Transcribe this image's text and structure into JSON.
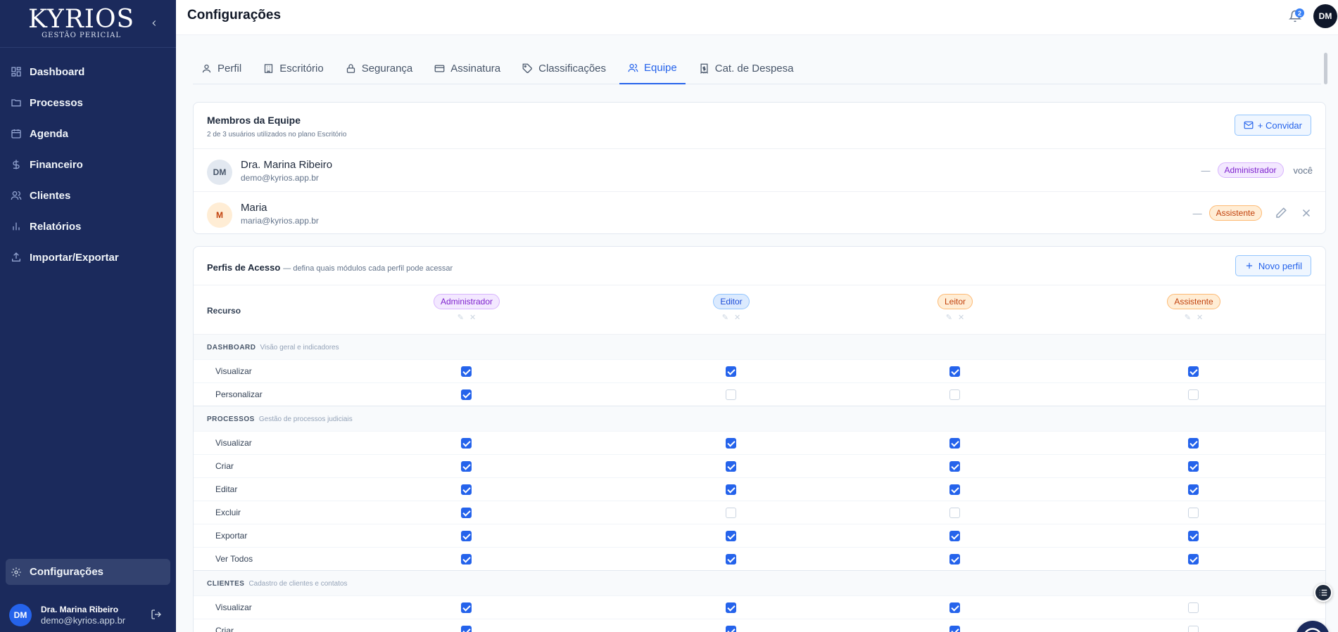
{
  "brand": {
    "name": "KYRIOS",
    "subtitle": "GESTÃO PERICIAL"
  },
  "sidebar": {
    "items": [
      {
        "label": "Dashboard",
        "icon": "grid-icon"
      },
      {
        "label": "Processos",
        "icon": "folder-icon"
      },
      {
        "label": "Agenda",
        "icon": "calendar-icon"
      },
      {
        "label": "Financeiro",
        "icon": "dollar-icon"
      },
      {
        "label": "Clientes",
        "icon": "users-icon"
      },
      {
        "label": "Relatórios",
        "icon": "bar-chart-icon"
      },
      {
        "label": "Importar/Exportar",
        "icon": "upload-icon"
      }
    ],
    "settings_label": "Configurações",
    "user": {
      "initials": "DM",
      "name": "Dra. Marina Ribeiro",
      "email": "demo@kyrios.app.br"
    }
  },
  "header": {
    "title": "Configurações",
    "notification_count": "2",
    "avatar_initials": "DM"
  },
  "tabs": [
    {
      "label": "Perfil",
      "icon": "user-icon"
    },
    {
      "label": "Escritório",
      "icon": "building-icon"
    },
    {
      "label": "Segurança",
      "icon": "lock-icon"
    },
    {
      "label": "Assinatura",
      "icon": "credit-card-icon"
    },
    {
      "label": "Classificações",
      "icon": "tag-icon"
    },
    {
      "label": "Equipe",
      "icon": "users-icon",
      "active": true
    },
    {
      "label": "Cat. de Despesa",
      "icon": "receipt-icon"
    }
  ],
  "team": {
    "title": "Membros da Equipe",
    "subtitle": "2 de 3 usuários utilizados no plano Escritório",
    "invite_label": "+ Convidar",
    "members": [
      {
        "initials": "DM",
        "name": "Dra. Marina Ribeiro",
        "email": "demo@kyrios.app.br",
        "dash": "—",
        "role": "Administrador",
        "suffix": "você"
      },
      {
        "initials": "M",
        "name": "Maria",
        "email": "maria@kyrios.app.br",
        "dash": "—",
        "role": "Assistente"
      }
    ]
  },
  "permissions": {
    "title": "Perfis de Acesso",
    "description": "— defina quais módulos cada perfil pode acessar",
    "new_profile_label": "Novo perfil",
    "resource_header": "Recurso",
    "roles": [
      "Administrador",
      "Editor",
      "Leitor",
      "Assistente"
    ],
    "sections": [
      {
        "name": "DASHBOARD",
        "desc": "Visão geral e indicadores",
        "rows": [
          {
            "label": "Visualizar",
            "values": [
              true,
              true,
              true,
              true
            ]
          },
          {
            "label": "Personalizar",
            "values": [
              true,
              false,
              false,
              false
            ]
          }
        ]
      },
      {
        "name": "PROCESSOS",
        "desc": "Gestão de processos judiciais",
        "rows": [
          {
            "label": "Visualizar",
            "values": [
              true,
              true,
              true,
              true
            ]
          },
          {
            "label": "Criar",
            "values": [
              true,
              true,
              true,
              true
            ]
          },
          {
            "label": "Editar",
            "values": [
              true,
              true,
              true,
              true
            ]
          },
          {
            "label": "Excluir",
            "values": [
              true,
              false,
              false,
              false
            ]
          },
          {
            "label": "Exportar",
            "values": [
              true,
              true,
              true,
              true
            ]
          },
          {
            "label": "Ver Todos",
            "values": [
              true,
              true,
              true,
              true
            ]
          }
        ]
      },
      {
        "name": "CLIENTES",
        "desc": "Cadastro de clientes e contatos",
        "rows": [
          {
            "label": "Visualizar",
            "values": [
              true,
              true,
              true,
              false
            ]
          },
          {
            "label": "Criar",
            "values": [
              true,
              true,
              true,
              false
            ]
          }
        ]
      }
    ]
  }
}
